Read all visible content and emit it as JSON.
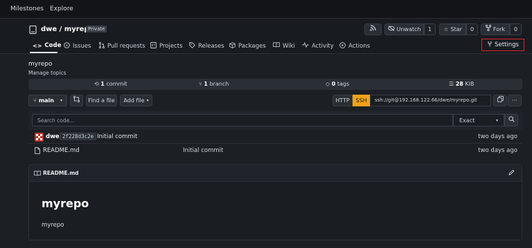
{
  "topnav": {
    "milestones": "Milestones",
    "explore": "Explore"
  },
  "repo": {
    "owner": "dwe",
    "sep": " / ",
    "name": "myrepo",
    "visibility": "Private",
    "rss_icon": "rss-icon",
    "unwatch_label": "Unwatch",
    "unwatch_count": "1",
    "star_label": "Star",
    "star_count": "0",
    "fork_label": "Fork",
    "fork_count": "0"
  },
  "tabs": [
    {
      "label": "Code",
      "icon": "code-icon"
    },
    {
      "label": "Issues",
      "icon": "issues-icon"
    },
    {
      "label": "Pull requests",
      "icon": "pull-request-icon"
    },
    {
      "label": "Projects",
      "icon": "projects-icon"
    },
    {
      "label": "Releases",
      "icon": "tag-icon"
    },
    {
      "label": "Packages",
      "icon": "package-icon"
    },
    {
      "label": "Wiki",
      "icon": "book-icon"
    },
    {
      "label": "Activity",
      "icon": "pulse-icon"
    },
    {
      "label": "Actions",
      "icon": "play-icon"
    }
  ],
  "settings_label": "Settings",
  "description": "myrepo",
  "manage_topics": "Manage topics",
  "stats": {
    "commits_num": "1",
    "commits_label": " commit",
    "branches_num": "1",
    "branches_label": " branch",
    "tags_num": "0",
    "tags_label": " tags",
    "size_num": "28",
    "size_label": " KiB"
  },
  "toolbar": {
    "branch": "main",
    "find_file": "Find a file",
    "add_file": "Add file",
    "http": "HTTP",
    "ssh": "SSH",
    "clone_url": "ssh://git@192.168.122.66/dwe/myrepo.git",
    "more": "···"
  },
  "search": {
    "placeholder": "Search code...",
    "mode": "Exact"
  },
  "latest_commit": {
    "author": "dwe",
    "sha": "2f228d3c2e",
    "message": "Initial commit",
    "time": "two days ago"
  },
  "files": [
    {
      "name": "README.md",
      "message": "Initial commit",
      "time": "two days ago"
    }
  ],
  "readme": {
    "filename": "README.md",
    "heading": "myrepo",
    "body": "myrepo"
  },
  "colors": {
    "accent_ssh": "#f6a01a",
    "settings_highlight": "#d9252c",
    "background": "#1c1f24"
  }
}
